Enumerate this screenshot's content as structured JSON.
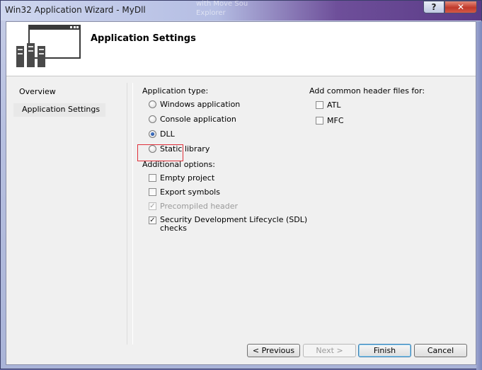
{
  "window": {
    "title": "Win32 Application Wizard - MyDll",
    "background_ghost_text": "with Move Sou\nExplorer",
    "help_label": "?",
    "close_label": "✕"
  },
  "header": {
    "title": "Application Settings"
  },
  "nav": {
    "items": [
      {
        "label": "Overview"
      },
      {
        "label": "Application Settings",
        "selected": true
      }
    ]
  },
  "app_type": {
    "label": "Application type:",
    "options": [
      {
        "label": "Windows application",
        "selected": false
      },
      {
        "label": "Console application",
        "selected": false
      },
      {
        "label": "DLL",
        "selected": true
      },
      {
        "label": "Static library",
        "selected": false
      }
    ]
  },
  "additional": {
    "label": "Additional options:",
    "options": [
      {
        "label": "Empty project",
        "checked": false,
        "enabled": true
      },
      {
        "label": "Export symbols",
        "checked": false,
        "enabled": true
      },
      {
        "label": "Precompiled header",
        "checked": true,
        "enabled": false
      },
      {
        "label": "Security Development Lifecycle (SDL)",
        "label2": "checks",
        "checked": true,
        "enabled": true
      }
    ]
  },
  "headers": {
    "label": "Add common header files for:",
    "options": [
      {
        "label": "ATL",
        "checked": false
      },
      {
        "label": "MFC",
        "checked": false
      }
    ]
  },
  "buttons": {
    "previous": "< Previous",
    "next": "Next >",
    "finish": "Finish",
    "cancel": "Cancel"
  },
  "colors": {
    "highlight_box": "#e0303a",
    "title_gradient_end": "#5a3a86"
  }
}
